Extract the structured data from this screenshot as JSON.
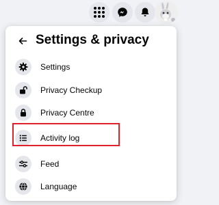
{
  "topbar": {
    "menu_icon": "menu-grid-icon",
    "messenger_icon": "messenger-icon",
    "notifications_icon": "bell-icon"
  },
  "panel": {
    "back_icon": "arrow-left-icon",
    "title": "Settings & privacy",
    "items": [
      {
        "label": "Settings",
        "icon": "gear-icon"
      },
      {
        "label": "Privacy Checkup",
        "icon": "lock-open-icon"
      },
      {
        "label": "Privacy Centre",
        "icon": "lock-icon"
      },
      {
        "label": "Activity log",
        "icon": "list-icon"
      },
      {
        "label": "Feed",
        "icon": "sliders-icon"
      },
      {
        "label": "Language",
        "icon": "globe-icon"
      }
    ]
  },
  "colors": {
    "page_background": "#f0f2f5",
    "icon_background": "#e4e6eb",
    "highlight_border": "#e0202a",
    "text": "#050505"
  }
}
